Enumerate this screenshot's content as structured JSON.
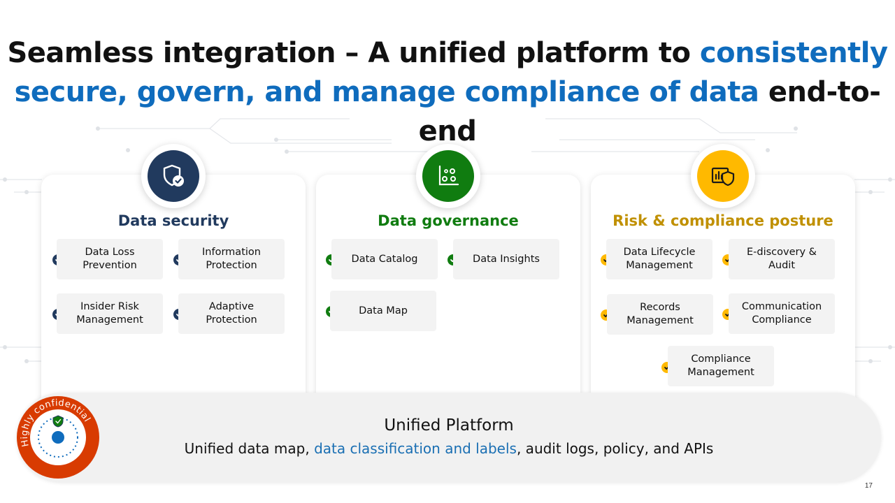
{
  "slide": {
    "title_part1": "Seamless integration – A unified platform to",
    "title_part2_blue": "consistently secure, govern, and manage compliance of data",
    "title_part3": "end-to-end",
    "page_number": "17"
  },
  "colors": {
    "security": "#213a5e",
    "governance": "#107c10",
    "risk": "#ffb900",
    "accent_blue": "#0f6cbd"
  },
  "cards": [
    {
      "title": "Data security",
      "icon": "shield-check-icon",
      "items": [
        "Data Loss Prevention",
        "Information Protection",
        "Insider Risk Management",
        "Adaptive Protection"
      ]
    },
    {
      "title": "Data governance",
      "icon": "chart-dots-icon",
      "items": [
        "Data Catalog",
        "Data Insights",
        "Data Map"
      ]
    },
    {
      "title": "Risk & compliance posture",
      "icon": "report-shield-icon",
      "items": [
        "Data Lifecycle Management",
        "E-discovery & Audit",
        "Records Management",
        "Communication Compliance",
        "Compliance Management"
      ]
    }
  ],
  "platform": {
    "title": "Unified Platform",
    "sub_pre": "Unified data map,",
    "sub_highlight": "data classification and labels",
    "sub_post": ", audit logs, policy, and APIs"
  },
  "sensitivity_label": {
    "text": "Highly confidential",
    "icon": "shield-label-icon"
  }
}
